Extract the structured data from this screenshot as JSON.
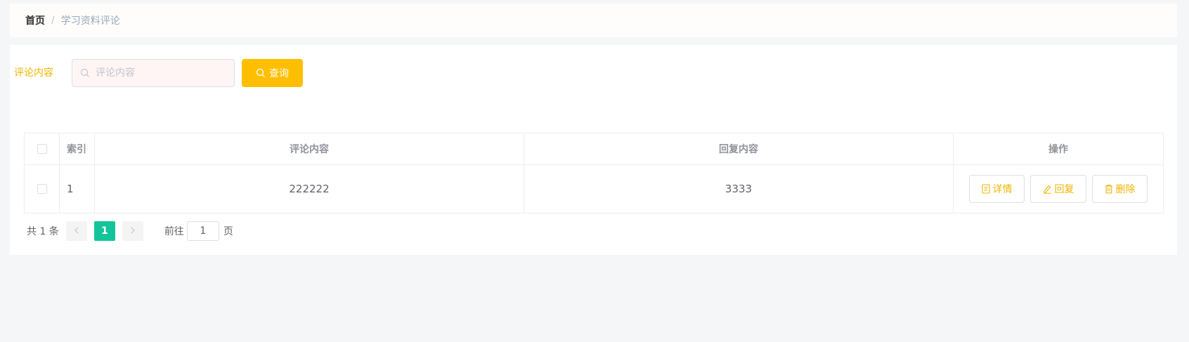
{
  "breadcrumb": {
    "home": "首页",
    "separator": "/",
    "current": "学习资料评论"
  },
  "search": {
    "label": "评论内容",
    "placeholder": "评论内容",
    "value": "",
    "button_label": "查询",
    "icon": "search-icon"
  },
  "table": {
    "headers": {
      "index": "索引",
      "comment": "评论内容",
      "reply": "回复内容",
      "operations": "操作"
    },
    "rows": [
      {
        "index": "1",
        "comment": "222222",
        "reply": "3333",
        "actions": {
          "detail": "详情",
          "reply": "回复",
          "delete": "删除"
        }
      }
    ]
  },
  "pagination": {
    "total_text": "共 1 条",
    "current_page": "1",
    "goto_label": "前往",
    "goto_value": "1",
    "page_suffix": "页"
  },
  "colors": {
    "accent": "#ffbf00",
    "label": "#f0b400",
    "pagination_active": "#13c49a",
    "background": "#f5f6f8"
  }
}
